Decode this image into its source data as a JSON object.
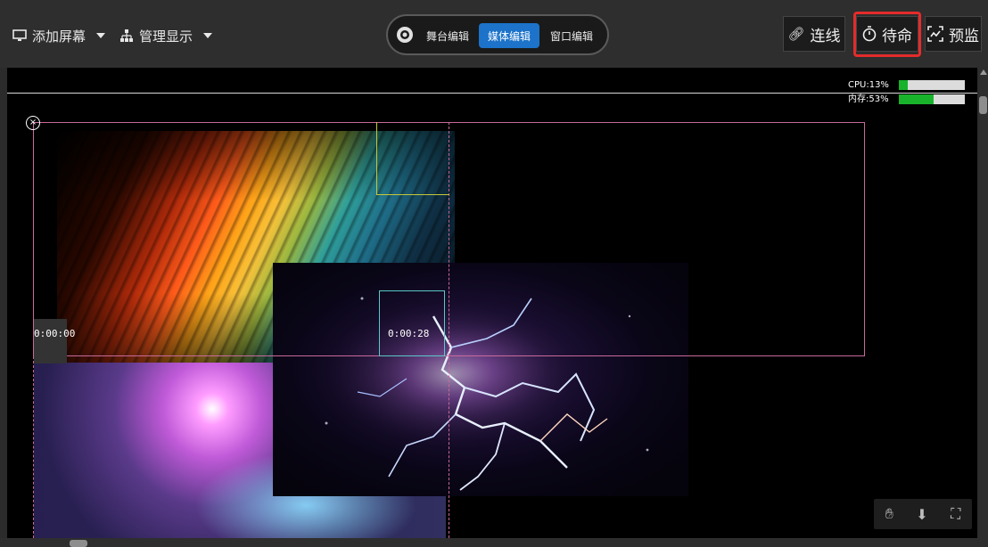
{
  "toolbar": {
    "add_screen": {
      "label": "添加屏幕",
      "icon": "monitor-icon"
    },
    "manage_display": {
      "label": "管理显示",
      "icon": "hierarchy-icon"
    },
    "segments": [
      {
        "label": "舞台编辑",
        "active": false
      },
      {
        "label": "媒体编辑",
        "active": true
      },
      {
        "label": "窗口编辑",
        "active": false
      }
    ],
    "connect": {
      "label": "连线",
      "icon": "link-icon"
    },
    "standby": {
      "label": "待命",
      "icon": "timer-icon",
      "highlighted": true
    },
    "preview": {
      "label": "预监",
      "icon": "preview-icon"
    }
  },
  "monitor": {
    "cpu_label": "CPU:13%",
    "cpu_percent": 13,
    "mem_label": "内存:53%",
    "mem_percent": 53
  },
  "timecodes": {
    "left": "0:00:00",
    "center": "0:00:28"
  },
  "colors": {
    "accent": "#1c73c9",
    "highlight": "#e52b2b",
    "meter_fill": "#18b32b",
    "outline_pink": "#c86a9a",
    "outline_yellow": "#c8c83a",
    "outline_cyan": "#5ac8c8"
  },
  "canvas_tools": [
    "hand-icon",
    "download-icon",
    "fit-screen-icon"
  ]
}
